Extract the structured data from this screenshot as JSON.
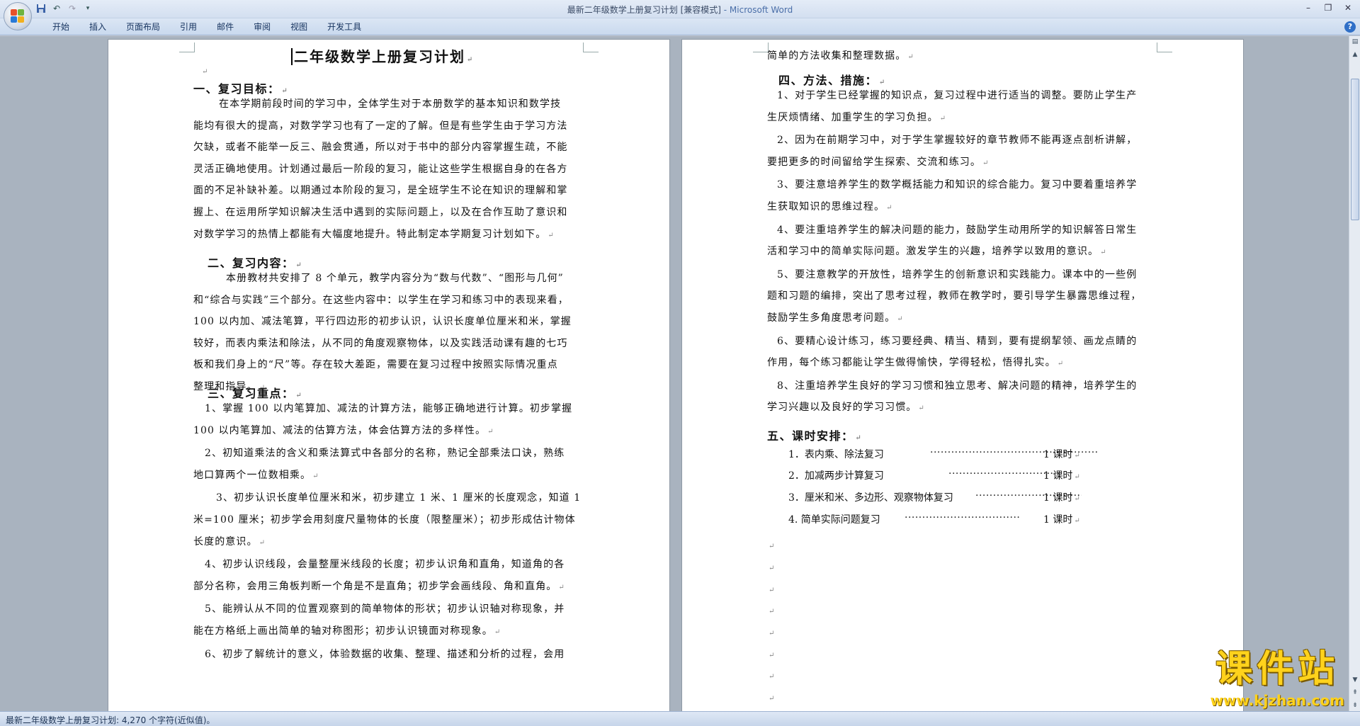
{
  "window": {
    "title": "最新二年级数学上册复习计划 [兼容模式]",
    "app_suffix": " - Microsoft Word"
  },
  "ribbon": {
    "tabs": [
      "开始",
      "插入",
      "页面布局",
      "引用",
      "邮件",
      "审阅",
      "视图",
      "开发工具"
    ]
  },
  "doc": {
    "title": "二年级数学上册复习计划",
    "s1_heading": "一、复习目标：",
    "s1_lines": [
      "在本学期前段时间的学习中，全体学生对于本册数学的基本知识和数学技",
      "能均有很大的提高，对数学学习也有了一定的了解。但是有些学生由于学习方法",
      "欠缺，或者不能举一反三、融会贯通，所以对于书中的部分内容掌握生疏，不能",
      "灵活正确地使用。计划通过最后一阶段的复习，能让这些学生根据自身的在各方",
      "面的不足补缺补差。以期通过本阶段的复习，是全班学生不论在知识的理解和掌",
      "握上、在运用所学知识解决生活中遇到的实际问题上，以及在合作互助了意识和",
      "对数学学习的热情上都能有大幅度地提升。特此制定本学期复习计划如下。"
    ],
    "s2_heading": "二、复习内容：",
    "s2_lines": [
      "本册教材共安排了 8 个单元，教学内容分为“数与代数”、“图形与几何”",
      "和“综合与实践”三个部分。在这些内容中：以学生在学习和练习中的表现来看，",
      "100 以内加、减法笔算，平行四边形的初步认识，认识长度单位厘米和米，掌握",
      "较好，而表内乘法和除法，从不同的角度观察物体，以及实践活动课有趣的七巧",
      "板和我们身上的“尺”等。存在较大差距，需要在复习过程中按照实际情况重点",
      "整理和指导。"
    ],
    "s3_heading": "三、复习重点：",
    "s3_lines": [
      "1、掌握 100 以内笔算加、减法的计算方法，能够正确地进行计算。初步掌握",
      "100 以内笔算加、减法的估算方法，体会估算方法的多样性。",
      "2、初知道乘法的含义和乘法算式中各部分的名称，熟记全部乘法口诀，熟练",
      "地口算两个一位数相乘。",
      "3、初步认识长度单位厘米和米，初步建立 1 米、1 厘米的长度观念，知道 1",
      "米=100 厘米；初步学会用刻度尺量物体的长度（限整厘米）；初步形成估计物体",
      "长度的意识。",
      "4、初步认识线段，会量整厘米线段的长度；初步认识角和直角，知道角的各",
      "部分名称，会用三角板判断一个角是不是直角；初步学会画线段、角和直角。",
      "5、能辨认从不同的位置观察到的简单物体的形状；初步认识轴对称现象，并",
      "能在方格纸上画出简单的轴对称图形；初步认识镜面对称现象。",
      "6、初步了解统计的意义，体验数据的收集、整理、描述和分析的过程，会用"
    ],
    "r_first": "简单的方法收集和整理数据。",
    "s4_heading": "四、方法、措施：",
    "s4_lines": [
      "1、对于学生已经掌握的知识点，复习过程中进行适当的调整。要防止学生产",
      "生厌烦情绪、加重学生的学习负担。",
      "2、因为在前期学习中，对于学生掌握较好的章节教师不能再逐点剖析讲解，",
      "要把更多的时间留给学生探索、交流和练习。",
      "3、要注意培养学生的数学概括能力和知识的综合能力。复习中要着重培养学",
      "生获取知识的思维过程。",
      "4、要注重培养学生的解决问题的能力，鼓励学生动用所学的知识解答日常生",
      "活和学习中的简单实际问题。激发学生的兴趣，培养学以致用的意识。",
      "5、要注意教学的开放性，培养学生的创新意识和实践能力。课本中的一些例",
      "题和习题的编排，突出了思考过程，教师在教学时，要引导学生暴露思维过程，",
      "鼓励学生多角度思考问题。",
      "6、要精心设计练习，练习要经典、精当、精到，要有提纲挈领、画龙点睛的",
      "作用，每个练习都能让学生做得愉快，学得轻松，悟得扎实。",
      "8、注重培养学生良好的学习习惯和独立思考、解决问题的精神，培养学生的",
      "学习兴趣以及良好的学习习惯。"
    ],
    "s5_heading": "五、课时安排：",
    "schedule": [
      {
        "name": "1．表内乘、除法复习",
        "dots": "··································································",
        "period": "1 课时"
      },
      {
        "name": "2．加减两步计算复习",
        "dots": "·················································",
        "period": "1 课时"
      },
      {
        "name": "3．厘米和米、多边形、观察物体复习",
        "dots": "·········································",
        "period": "1 课时"
      },
      {
        "name": "4. 简单实际问题复习",
        "dots": "·············································",
        "period": "1 课时"
      }
    ],
    "para_mark": "↵"
  },
  "status": {
    "text": "最新二年级数学上册复习计划: 4,270 个字符(近似值)。"
  },
  "watermark": {
    "brand": "课件站",
    "url": "www.kjzhan.com"
  }
}
